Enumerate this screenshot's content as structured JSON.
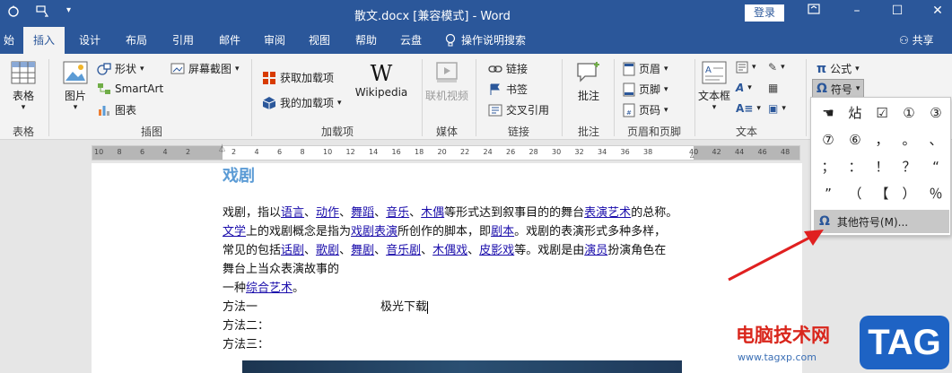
{
  "titlebar": {
    "title": "散文.docx [兼容模式]  -  Word",
    "login": "登录",
    "icons": [
      "autosave-icon",
      "touch-mode-icon",
      "customize-qat-icon"
    ]
  },
  "tabs": {
    "items": [
      "始",
      "插入",
      "设计",
      "布局",
      "引用",
      "邮件",
      "审阅",
      "视图",
      "帮助",
      "云盘"
    ],
    "tell_me": "操作说明搜索",
    "share": "共享",
    "active": "插入"
  },
  "ribbon": {
    "tables": {
      "label": "表格",
      "group": "表格"
    },
    "illustrations": {
      "picture": "图片",
      "shapes": "形状",
      "smartart": "SmartArt",
      "chart": "图表",
      "screenshot": "屏幕截图",
      "group": "插图"
    },
    "addins": {
      "get": "获取加载项",
      "my": "我的加载项",
      "wikipedia": "Wikipedia",
      "group": "加载项"
    },
    "media": {
      "video": "联机视频",
      "group": "媒体"
    },
    "links": {
      "link": "链接",
      "bookmark": "书签",
      "crossref": "交叉引用",
      "group": "链接"
    },
    "comments": {
      "comment": "批注",
      "group": "批注"
    },
    "header_footer": {
      "header": "页眉",
      "footer": "页脚",
      "page_number": "页码",
      "group": "页眉和页脚"
    },
    "text": {
      "textbox": "文本框",
      "group": "文本"
    },
    "symbols": {
      "equation": "公式",
      "symbol": "符号"
    }
  },
  "ruler": {
    "ticks": [
      "10",
      "8",
      "6",
      "4",
      "2",
      "",
      "2",
      "4",
      "6",
      "8",
      "10",
      "12",
      "14",
      "16",
      "18",
      "20",
      "22",
      "24",
      "26",
      "28",
      "30",
      "32",
      "34",
      "36",
      "38",
      "",
      "40",
      "42",
      "44",
      "46",
      "48"
    ]
  },
  "document": {
    "heading": "戏剧",
    "p1": {
      "a": "戏剧，指以",
      "l1": "语言",
      "b": "、",
      "l2": "动作",
      "c": "、",
      "l3": "舞蹈",
      "d": "、",
      "l4": "音乐",
      "e": "、",
      "l5": "木偶",
      "f": "等形式达到叙事目的的舞台",
      "l6": "表演艺术",
      "g": "的总称。"
    },
    "p2": {
      "l1": "文学",
      "a": "上的戏剧概念是指为",
      "l2": "戏剧表演",
      "b": "所创作的脚本，即",
      "l3": "剧本",
      "c": "。戏剧的表演形式多种多样，"
    },
    "p3": {
      "a": "常见的包括",
      "l1": "话剧",
      "b": "、",
      "l2": "歌剧",
      "c": "、",
      "l3": "舞剧",
      "d": "、",
      "l4": "音乐剧",
      "e": "、",
      "l5": "木偶戏",
      "f": "、",
      "l6": "皮影戏",
      "g": "等。戏剧是由",
      "l7": "演员",
      "h": "扮演角色在"
    },
    "p4": "舞台上当众表演故事的",
    "p5": {
      "a": "一种",
      "l1": "综合艺术",
      "b": "。"
    },
    "m1": "方法一",
    "m1b": "极光下载",
    "m2": "方法二：",
    "m3": "方法三："
  },
  "symbol_panel": {
    "symbols": [
      "☚",
      "炶",
      "☑",
      "①",
      "③",
      "⑦",
      "⑥",
      "，",
      "。",
      "、",
      "；",
      "：",
      "！",
      "？",
      "“",
      "”",
      "（",
      "【",
      "）",
      "％"
    ],
    "more": "其他符号(M)..."
  },
  "watermark": {
    "site": "电脑技术网",
    "url": "www.tagxp.com",
    "tag": "TAG"
  }
}
